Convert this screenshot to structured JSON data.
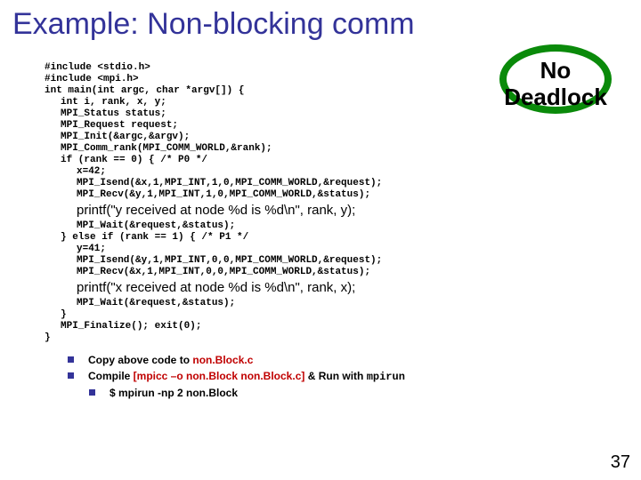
{
  "title": "Example: Non-blocking comm",
  "badge": {
    "line1": "No",
    "line2": "Deadlock"
  },
  "code": {
    "l1": "#include <stdio.h>",
    "l2": "#include <mpi.h>",
    "l3": "int main(int argc, char *argv[]) {",
    "l4": "int i, rank, x, y;",
    "l5": "MPI_Status status;",
    "l6": "MPI_Request request;",
    "l7": "MPI_Init(&argc,&argv);",
    "l8": "MPI_Comm_rank(MPI_COMM_WORLD,&rank);",
    "l9": "if (rank == 0) { /* P0 */",
    "l10": "x=42;",
    "l11": "MPI_Isend(&x,1,MPI_INT,1,0,MPI_COMM_WORLD,&request);",
    "l12": "MPI_Recv(&y,1,MPI_INT,1,0,MPI_COMM_WORLD,&status);",
    "printf1": "printf(\"y received at node %d is %d\\n\", rank, y);",
    "l13": "MPI_Wait(&request,&status);",
    "l14": "} else if (rank == 1) { /* P1 */",
    "l15": "y=41;",
    "l16": "MPI_Isend(&y,1,MPI_INT,0,0,MPI_COMM_WORLD,&request);",
    "l17": "MPI_Recv(&x,1,MPI_INT,0,0,MPI_COMM_WORLD,&status);",
    "printf2": "printf(\"x received at node %d is %d\\n\", rank, x);",
    "l18": "MPI_Wait(&request,&status);",
    "l19": "}",
    "l20": "MPI_Finalize(); exit(0);",
    "l21": "}"
  },
  "notes": {
    "n1a": "Copy above code to ",
    "n1b": "non.Block.c",
    "n2a": "Compile ",
    "n2b": "[mpicc –o non.Block non.Block.c]",
    "n2c": " & Run with ",
    "n2d": "mpirun",
    "n3": "$ mpirun -np 2 non.Block"
  },
  "pagenum": "37"
}
